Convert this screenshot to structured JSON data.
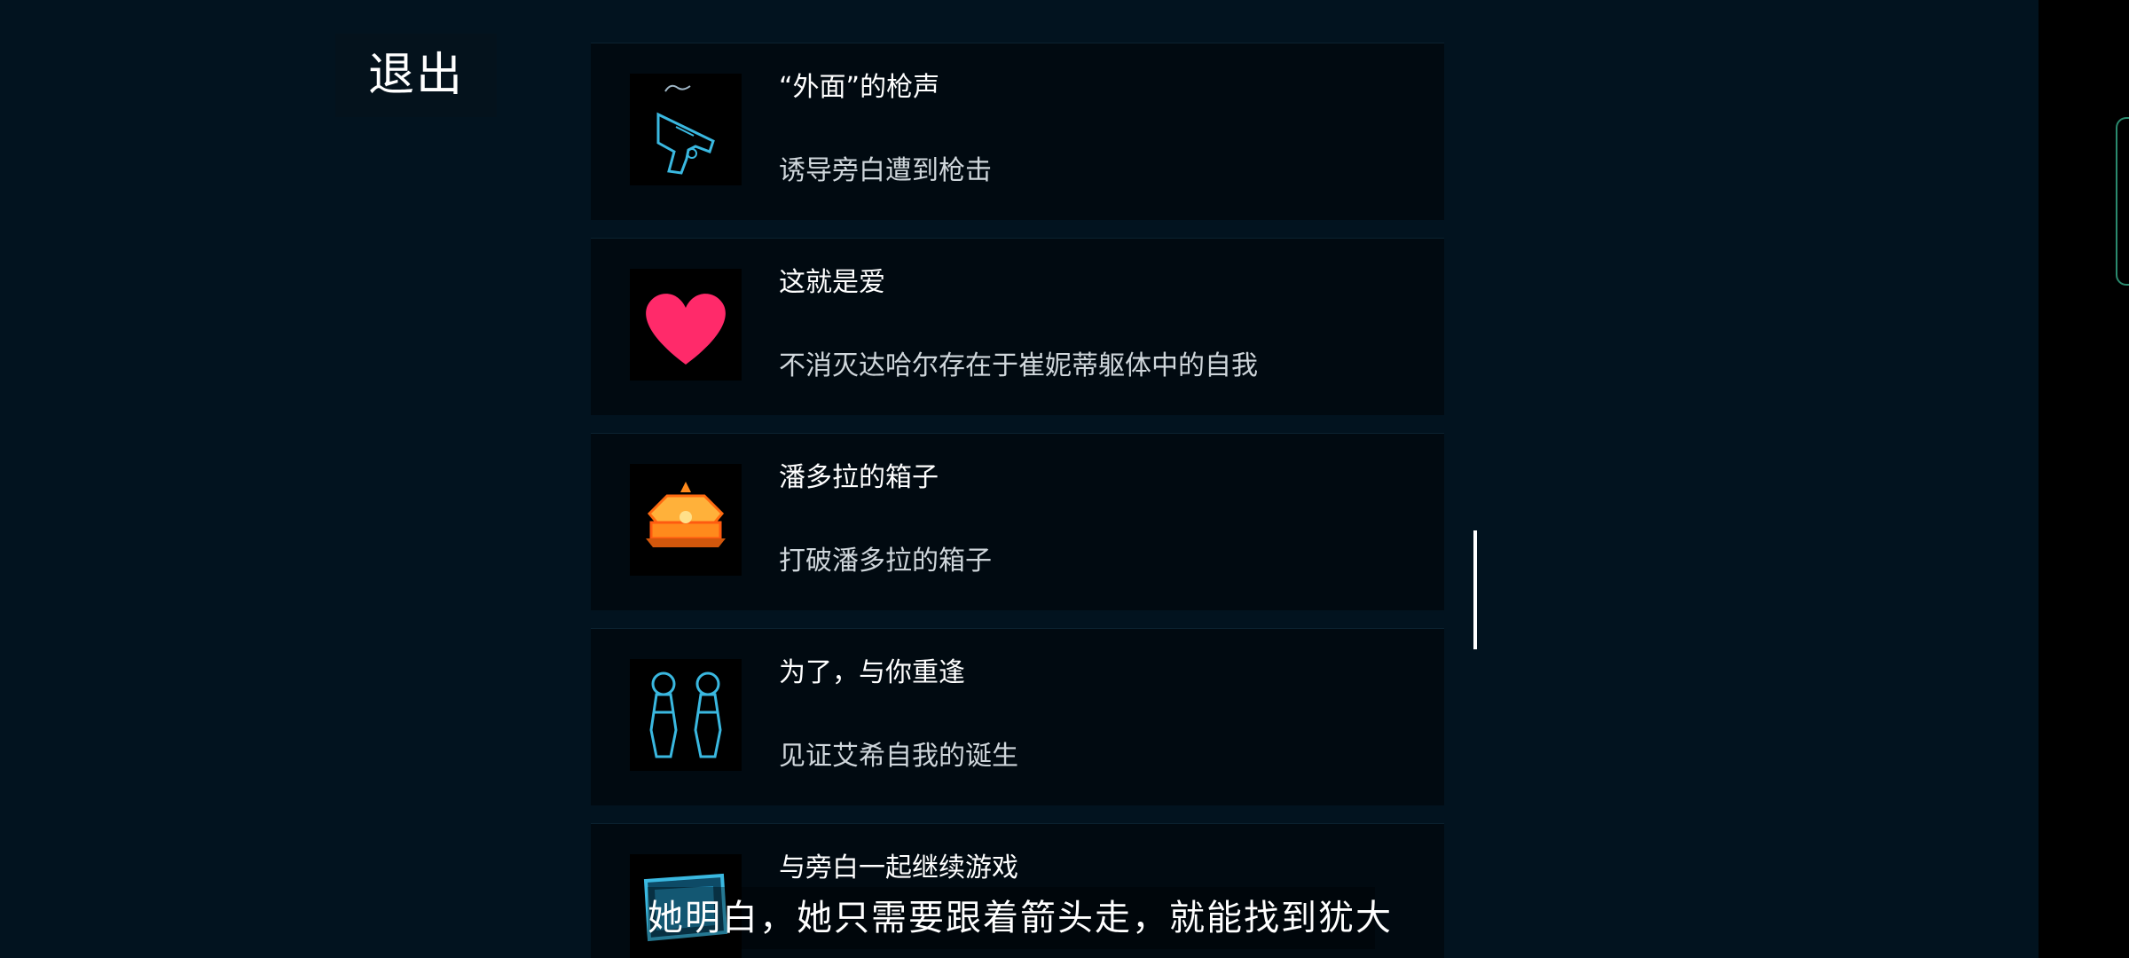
{
  "exit_button": {
    "label": "退出"
  },
  "achievements": [
    {
      "title": "“外面”的枪声",
      "description": "诱导旁白遭到枪击",
      "icon": "pistol-icon"
    },
    {
      "title": "这就是爱",
      "description": "不消灭达哈尔存在于崔妮蒂躯体中的自我",
      "icon": "heart-icon"
    },
    {
      "title": "潘多拉的箱子",
      "description": "打破潘多拉的箱子",
      "icon": "treasure-box-icon"
    },
    {
      "title": "为了，与你重逢",
      "description": "见证艾希自我的诞生",
      "icon": "twin-figures-icon"
    },
    {
      "title": "与旁白一起继续游戏",
      "description": "",
      "icon": "monitor-icon"
    }
  ],
  "subtitle": {
    "text": "她明白，她只需要跟着箭头走，就能找到犹大"
  },
  "colors": {
    "background": "#02131f",
    "card": "#010a11",
    "icon_cyan": "#3ab8e0",
    "heart_pink": "#ff2a6a",
    "box_orange": "#ff8a1c"
  }
}
